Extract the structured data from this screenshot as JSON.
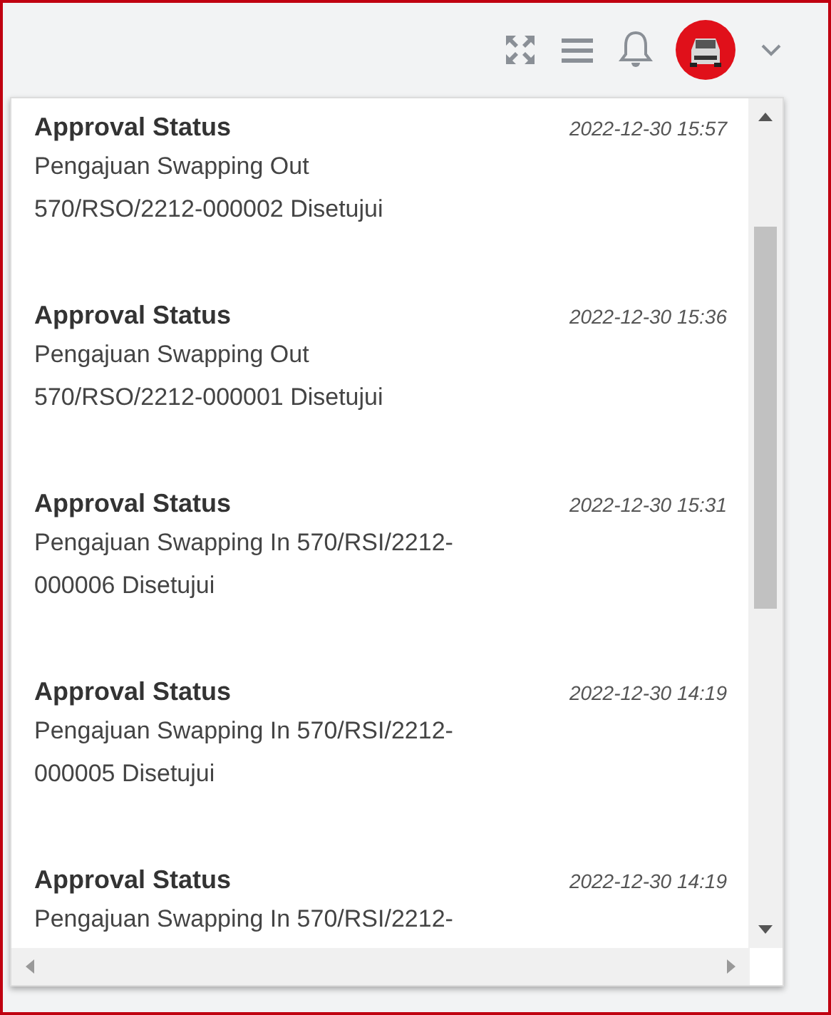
{
  "notifications": [
    {
      "title": "Approval Status",
      "time": "2022-12-30 15:57",
      "message": "Pengajuan Swapping Out 570/RSO/2212-000002 Disetujui"
    },
    {
      "title": "Approval Status",
      "time": "2022-12-30 15:36",
      "message": "Pengajuan Swapping Out 570/RSO/2212-000001 Disetujui"
    },
    {
      "title": "Approval Status",
      "time": "2022-12-30 15:31",
      "message": "Pengajuan Swapping In 570/RSI/2212-000006 Disetujui"
    },
    {
      "title": "Approval Status",
      "time": "2022-12-30 14:19",
      "message": "Pengajuan Swapping In 570/RSI/2212-000005 Disetujui"
    },
    {
      "title": "Approval Status",
      "time": "2022-12-30 14:19",
      "message": "Pengajuan Swapping In 570/RSI/2212-"
    }
  ]
}
